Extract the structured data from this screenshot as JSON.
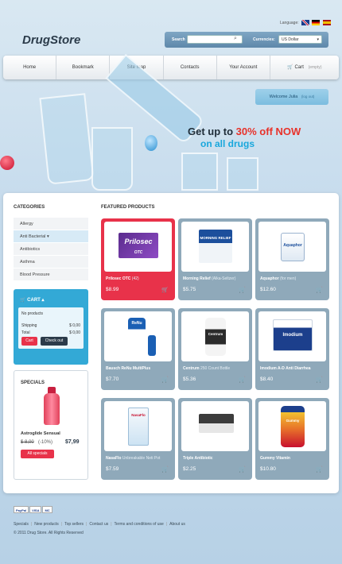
{
  "header": {
    "logo": "DrugStore",
    "language_label": "Language:",
    "search_label": "Search",
    "search_placeholder": "",
    "currencies_label": "Currencies:",
    "currency_selected": "US Dollar"
  },
  "nav": {
    "items": [
      "Home",
      "Bookmark",
      "Site map",
      "Contacts",
      "Your Account"
    ],
    "cart_label": "Cart",
    "cart_status": "(empty)"
  },
  "welcome": {
    "text": "Welcome Julia",
    "logout": "(log out)"
  },
  "promo": {
    "line1_prefix": "Get up to ",
    "discount": "30% off",
    "now": "NOW",
    "line2": "on all drugs"
  },
  "categories": {
    "title": "CATEGORIES",
    "items": [
      "Allergy",
      "Anti Bacterial",
      "Antibiotics",
      "Asthma",
      "Blood Pressure"
    ]
  },
  "cart": {
    "title": "CART",
    "empty": "No products",
    "shipping_label": "Shipping",
    "shipping_value": "$ 0,00",
    "total_label": "Total",
    "total_value": "$ 0,00",
    "cart_button": "Cart",
    "checkout_button": "Check out"
  },
  "specials": {
    "title": "SPECIALS",
    "product": "Astroglide Sensual",
    "old_price": "$ 8,00",
    "discount": "(-10%)",
    "price": "$7,99",
    "button": "All specials"
  },
  "featured": {
    "title": "FEATURED PRODUCTS",
    "products": [
      {
        "name": "Prilosec OTC",
        "sub": "(42)",
        "price": "$8.99"
      },
      {
        "name": "Morning Relief",
        "sub": "(Alka-Seltzer)",
        "price": "$5.75"
      },
      {
        "name": "Aquaphor",
        "sub": "(for men)",
        "price": "$12.60"
      },
      {
        "name": "Bausch ReNu MultiPlus",
        "sub": "",
        "price": "$7.70"
      },
      {
        "name": "Centrum",
        "sub": "250 Count Bottle",
        "price": "$5.36"
      },
      {
        "name": "Imodium A-D Anti Diarrhea",
        "sub": "",
        "price": "$8.40"
      },
      {
        "name": "NasaFlo",
        "sub": "Unbreakable Neti Pot",
        "price": "$7.59"
      },
      {
        "name": "Triple Antibiotic",
        "sub": "",
        "price": "$2.25"
      },
      {
        "name": "Gummy Vitamin",
        "sub": "",
        "price": "$10.80"
      }
    ],
    "box_labels": {
      "prilosec": "Prilosec",
      "prilosec_sub": "OTC",
      "morning": "MORNING RELIEF",
      "aquaphor": "Aquaphor",
      "renu": "ReNu",
      "centrum": "Centrum",
      "imodium": "Imodium",
      "nasaflo": "NasaFlo",
      "gummy": "Gummy"
    }
  },
  "footer": {
    "payments": [
      "PayPal",
      "VISA",
      "MC"
    ],
    "links": [
      "Specials",
      "New products",
      "Top sellers",
      "Contact us",
      "Terms and conditions of use",
      "About us"
    ],
    "copyright": "© 2011 Drug Store. All Rights Reserved"
  },
  "colors": {
    "accent_red": "#e8324a",
    "accent_blue": "#33a9d6",
    "card_grey": "#8fa9ba",
    "promo_blue": "#18a7dc"
  }
}
